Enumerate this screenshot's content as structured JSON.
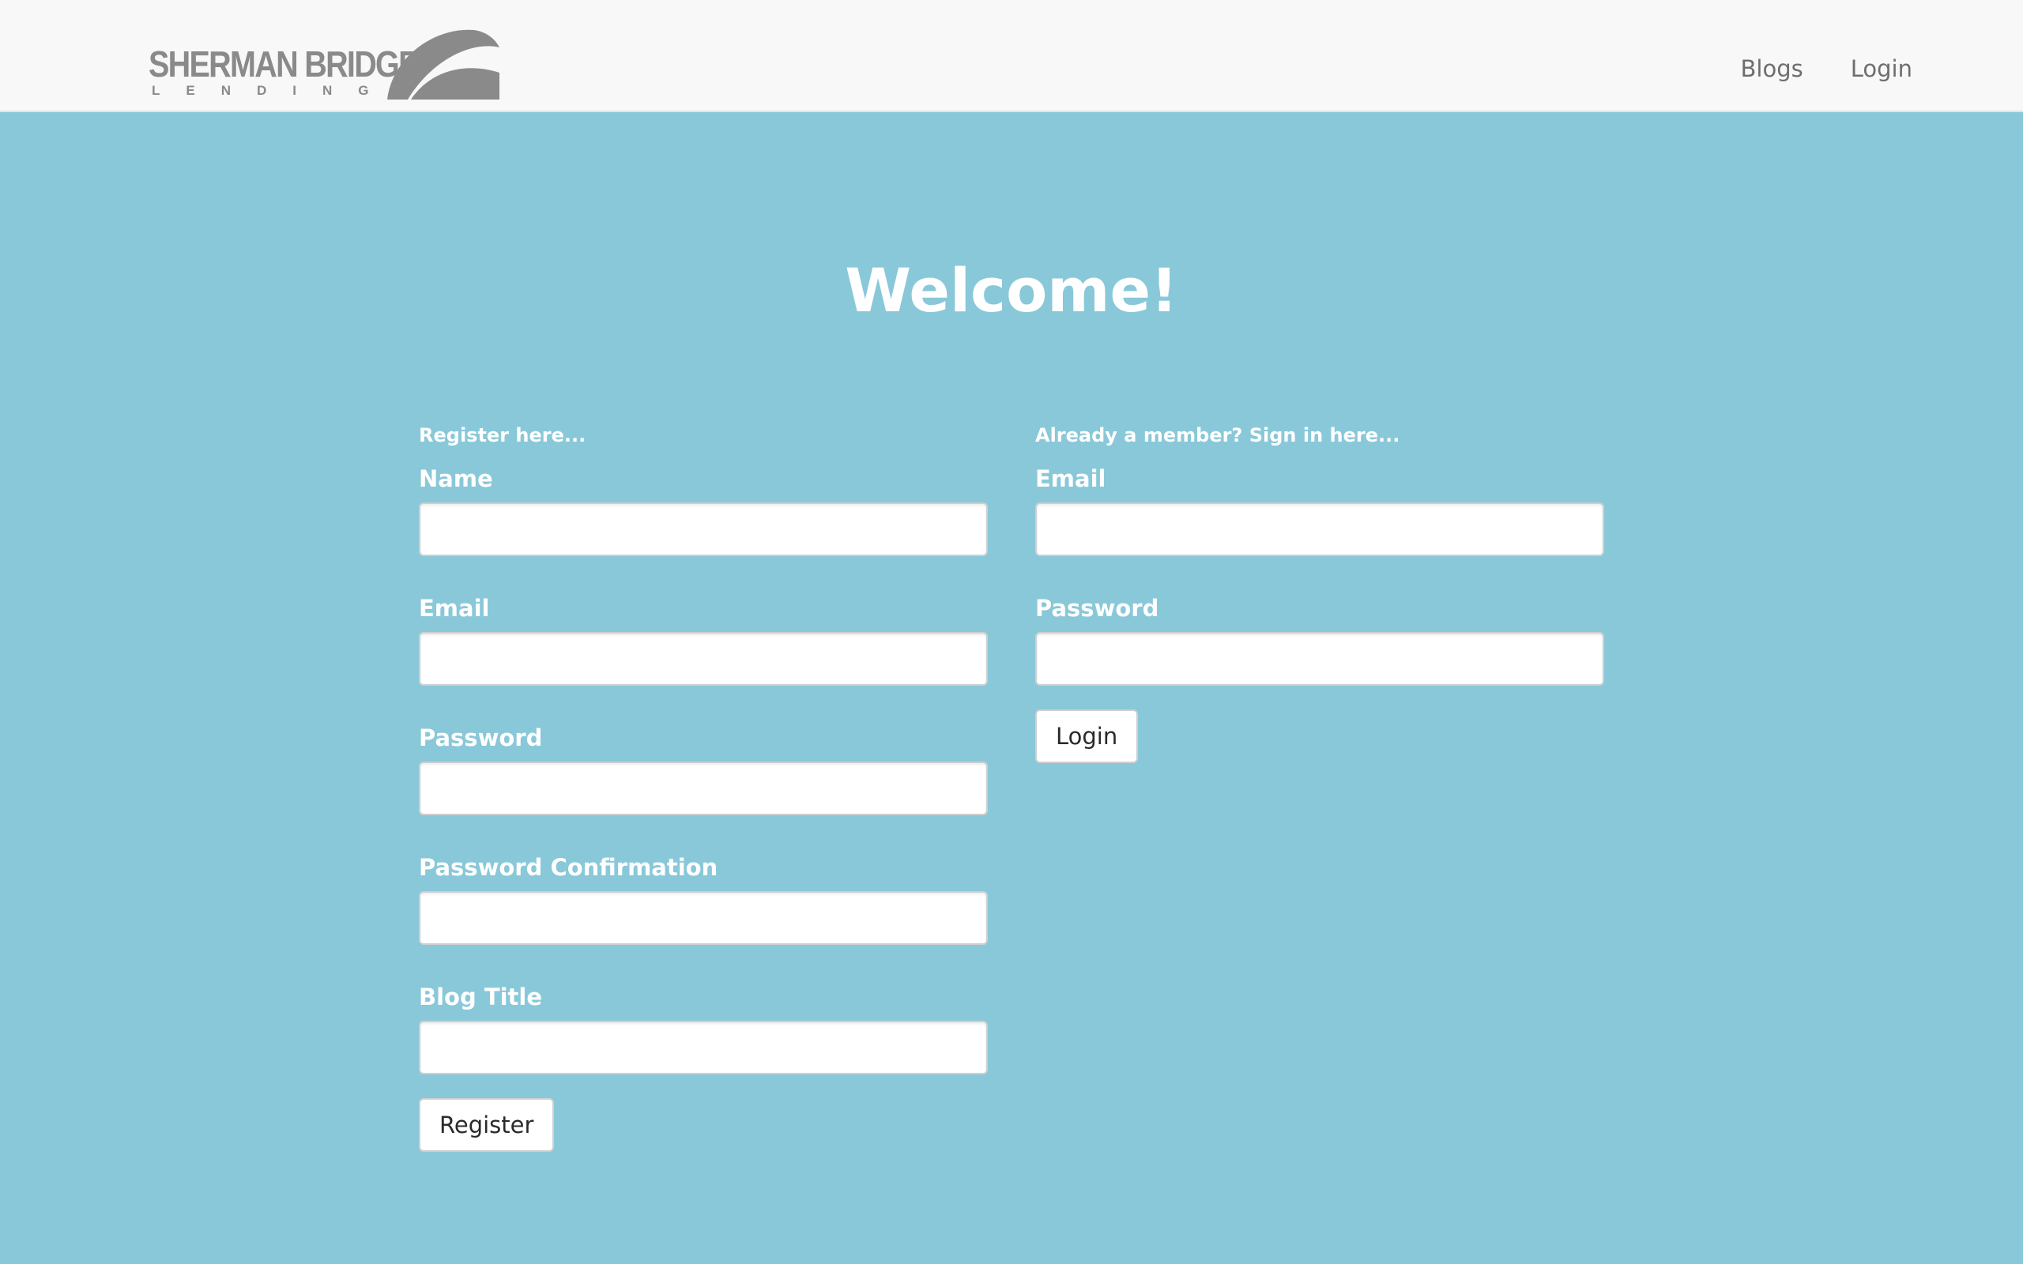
{
  "header": {
    "logo": {
      "main_text": "SHERMAN BRIDGE",
      "sub_text": "LENDING",
      "color": "#8a8a8a"
    },
    "nav": [
      {
        "label": "Blogs"
      },
      {
        "label": "Login"
      }
    ]
  },
  "main": {
    "title": "Welcome!",
    "register": {
      "intro": "Register here...",
      "fields": [
        {
          "label": "Name",
          "value": "",
          "type": "text"
        },
        {
          "label": "Email",
          "value": "",
          "type": "email"
        },
        {
          "label": "Password",
          "value": "",
          "type": "password"
        },
        {
          "label": "Password Confirmation",
          "value": "",
          "type": "password"
        },
        {
          "label": "Blog Title",
          "value": "",
          "type": "text"
        }
      ],
      "submit_label": "Register"
    },
    "login": {
      "intro": "Already a member? Sign in here...",
      "fields": [
        {
          "label": "Email",
          "value": "",
          "type": "email"
        },
        {
          "label": "Password",
          "value": "",
          "type": "password"
        }
      ],
      "submit_label": "Login"
    }
  },
  "colors": {
    "page_background": "#89c8d9",
    "header_background": "#f8f8f8",
    "nav_text": "#6e6e6e",
    "heading_text": "#ffffff"
  }
}
